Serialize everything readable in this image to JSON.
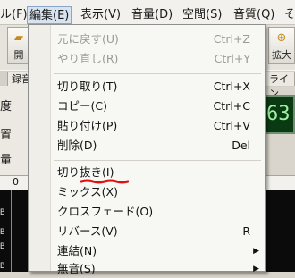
{
  "menubar": {
    "items": [
      {
        "label": "ル(F)"
      },
      {
        "label": "編集(E)"
      },
      {
        "label": "表示(V)"
      },
      {
        "label": "音量(D)"
      },
      {
        "label": "空間(S)"
      },
      {
        "label": "音質(Q)"
      },
      {
        "label": "そ"
      }
    ]
  },
  "toolbar": {
    "left_label": "開",
    "right_label": "拡大"
  },
  "tabs": {
    "left": "録音",
    "right": "ライン"
  },
  "left_panel": {
    "lines": [
      "度",
      "置",
      "量"
    ]
  },
  "display": {
    "value": "63"
  },
  "ruler": {
    "value": "0"
  },
  "waveform": {
    "labels": [
      "B",
      "B",
      "B",
      "B"
    ]
  },
  "edit_menu": {
    "items": [
      {
        "label": "元に戻す(U)",
        "shortcut": "Ctrl+Z",
        "disabled": true
      },
      {
        "label": "やり直し(R)",
        "shortcut": "Ctrl+Y",
        "disabled": true
      },
      {
        "label": "切り取り(T)",
        "shortcut": "Ctrl+X"
      },
      {
        "label": "コピー(C)",
        "shortcut": "Ctrl+C"
      },
      {
        "label": "貼り付け(P)",
        "shortcut": "Ctrl+V"
      },
      {
        "label": "削除(D)",
        "shortcut": "Del"
      },
      {
        "label": "切り抜き(I)",
        "shortcut": ""
      },
      {
        "label": "ミックス(X)",
        "shortcut": ""
      },
      {
        "label": "クロスフェード(O)",
        "shortcut": ""
      },
      {
        "label": "リバース(V)",
        "shortcut": "R"
      },
      {
        "label": "連結(N)",
        "shortcut": "",
        "submenu": true
      },
      {
        "label": "無音(S)",
        "shortcut": "",
        "submenu": true
      }
    ]
  },
  "colors": {
    "menu_highlight": "#d8e3f0",
    "annotation_red": "#e01010",
    "display_text": "#9ef0a2"
  }
}
